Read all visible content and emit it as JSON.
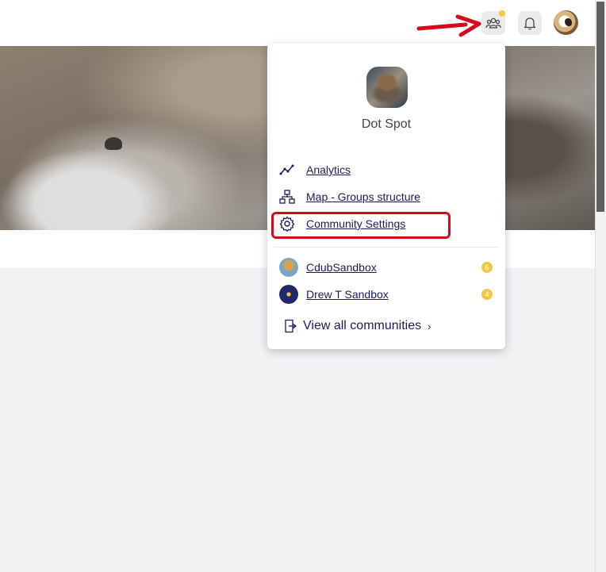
{
  "header": {
    "communities_icon": "people-group-icon",
    "notifications_icon": "bell-icon",
    "has_new_indicator": true,
    "accent_color": "#f5c842"
  },
  "dropdown": {
    "community_name": "Dot Spot",
    "menu": [
      {
        "label": "Analytics",
        "icon": "analytics-icon"
      },
      {
        "label": "Map - Groups structure",
        "icon": "hierarchy-icon"
      },
      {
        "label": "Community Settings",
        "icon": "gear-icon"
      }
    ],
    "communities": [
      {
        "label": "CdubSandbox",
        "badge": "6"
      },
      {
        "label": "Drew T Sandbox",
        "badge": "4"
      }
    ],
    "view_all_label": "View all communities",
    "view_all_chevron": "›"
  },
  "annotation": {
    "highlight_color": "#d4091e"
  }
}
